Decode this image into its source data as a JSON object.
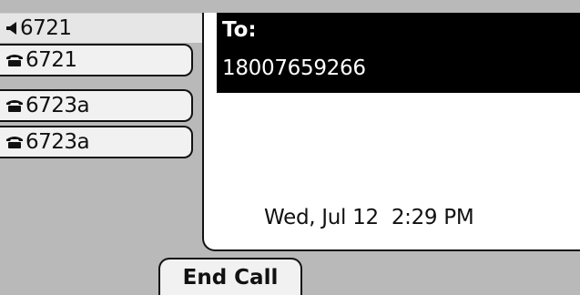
{
  "line_panel": {
    "header": {
      "icon": "speaker-icon",
      "label": "6721"
    },
    "keys": [
      {
        "icon": "phone-icon",
        "label": "6721"
      },
      {
        "icon": "phone-icon",
        "label": "6723a"
      },
      {
        "icon": "phone-icon",
        "label": "6723a"
      }
    ]
  },
  "call": {
    "to_label": "To:",
    "number": "18007659266",
    "datetime": "Wed, Jul 12  2:29 PM"
  },
  "softkeys": {
    "end_call_label": "End Call"
  }
}
